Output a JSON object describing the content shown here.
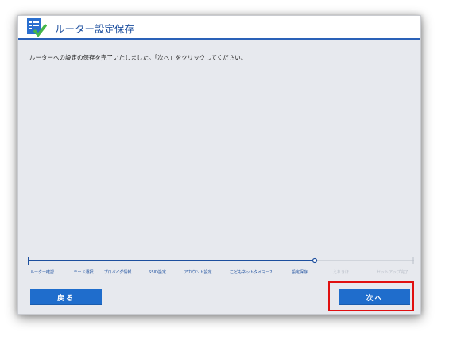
{
  "window": {
    "title": "ルーター設定保存",
    "message": "ルーターへの設定の保存を完了いたしました。「次へ」をクリックしてください。"
  },
  "steps": [
    {
      "label": "ルーター確認",
      "active": true
    },
    {
      "label": "モード選択",
      "active": true
    },
    {
      "label": "プロバイダ情報",
      "active": true
    },
    {
      "label": "SSID設定",
      "active": true
    },
    {
      "label": "アカウント設定",
      "active": true
    },
    {
      "label": "こどもネットタイマー2",
      "active": true
    },
    {
      "label": "設定保存",
      "active": true
    },
    {
      "label": "えれきほ",
      "active": false
    },
    {
      "label": "セットアップ完了",
      "active": false
    }
  ],
  "buttons": {
    "back_label": "戻る",
    "next_label": "次へ"
  },
  "colors": {
    "accent": "#1f6dcc",
    "title_text": "#1d4f9e",
    "highlight": "#e01010"
  }
}
